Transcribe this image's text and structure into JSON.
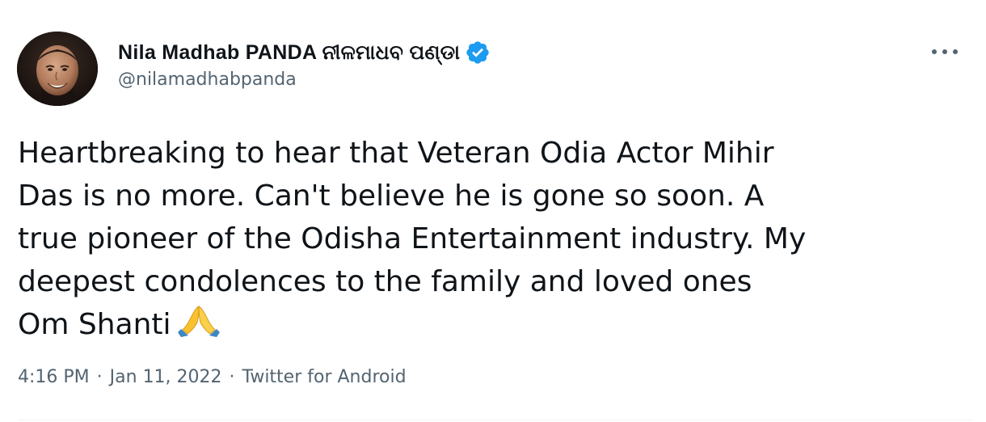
{
  "tweet": {
    "author": {
      "display_name": "Nila Madhab PANDA ନୀଳମାଧବ ପଣ୍ଡା",
      "handle": "@nilamadhabpanda",
      "verified": true
    },
    "body_lines": [
      "Heartbreaking to hear that Veteran Odia Actor Mihir",
      "Das is no more. Can't believe he is gone so soon. A",
      "true pioneer of the Odisha Entertainment industry. My",
      "deepest condolences to the family and loved ones",
      "Om Shanti"
    ],
    "emoji": "folded-hands",
    "meta": {
      "time": "4:16 PM",
      "separator": "·",
      "date": "Jan 11, 2022",
      "source": "Twitter for Android"
    }
  },
  "colors": {
    "text_primary": "#0f1419",
    "text_secondary": "#536471",
    "verified_blue": "#1d9bf0",
    "divider": "#eff3f4",
    "emoji_yellow": "#f9c12f",
    "emoji_sleeve": "#3b88c3"
  },
  "icons": {
    "verified": "verified-badge-icon",
    "more": "more-options-icon",
    "avatar": "profile-photo"
  }
}
